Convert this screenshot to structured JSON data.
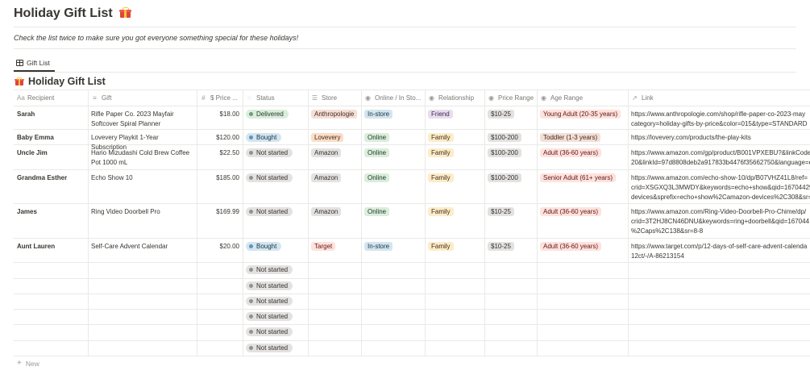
{
  "page": {
    "title": "Holiday Gift List",
    "title_emoji": "gift-icon",
    "description": "Check the list twice to make sure you got everyone something special for these holidays!"
  },
  "view_tab": {
    "label": "Gift List",
    "icon": "table-icon"
  },
  "database": {
    "title": "Holiday Gift List",
    "icon": "gift-icon"
  },
  "columns": [
    {
      "label": "Recipient",
      "icon": "Aa"
    },
    {
      "label": "Gift",
      "icon": "text-icon"
    },
    {
      "label": "$ Price ...",
      "icon": "#"
    },
    {
      "label": "Status",
      "icon": "status-icon"
    },
    {
      "label": "Store",
      "icon": "list-icon"
    },
    {
      "label": "Online / In Sto...",
      "icon": "select-icon"
    },
    {
      "label": "Relationship",
      "icon": "select-icon"
    },
    {
      "label": "Price Range",
      "icon": "select-icon"
    },
    {
      "label": "Age Range",
      "icon": "select-icon"
    },
    {
      "label": "Link",
      "icon": "link-icon"
    }
  ],
  "rows": [
    {
      "recipient": "Sarah",
      "gift": "Rifle Paper Co. 2023 Mayfair Softcover Spiral Planner",
      "price": "$18.00",
      "status": "Delivered",
      "store": "Anthropologie",
      "online": "In-store",
      "relationship": "Friend",
      "price_range": "$10-25",
      "age_range": "Young Adult (20-35 years)",
      "link": "https://www.anthropologie.com/shop/rifle-paper-co-2023-may\ncategory=holiday-gifts-by-price&color=015&type=STANDARD"
    },
    {
      "recipient": "Baby Emma",
      "gift": "Lovevery Playkit 1-Year Subscription",
      "price": "$120.00",
      "status": "Bought",
      "store": "Lovevery",
      "online": "Online",
      "relationship": "Family",
      "price_range": "$100-200",
      "age_range": "Toddler (1-3 years)",
      "link": "https://lovevery.com/products/the-play-kits"
    },
    {
      "recipient": "Uncle Jim",
      "gift": "Hario Mizudashi Cold Brew Coffee Pot 1000 mL",
      "price": "$22.50",
      "status": "Not started",
      "store": "Amazon",
      "online": "Online",
      "relationship": "Family",
      "price_range": "$100-200",
      "age_range": "Adult (36-60 years)",
      "link": "https://www.amazon.com/gp/product/B001VPXEBU?&linkCode\n20&linkId=97d8808deb2a917833b4476f35662750&language=e"
    },
    {
      "recipient": "Grandma Esther",
      "gift": "Echo Show 10",
      "price": "$185.00",
      "status": "Not started",
      "store": "Amazon",
      "online": "Online",
      "relationship": "Family",
      "price_range": "$100-200",
      "age_range": "Senior Adult (61+ years)",
      "link": "https://www.amazon.com/echo-show-10/dp/B07VHZ41L8/ref=\ncrid=XSGXQ3L3MWDY&keywords=echo+show&qid=16704429\ndevices&sprefix=echo+show%2Camazon-devices%2C308&sr=1"
    },
    {
      "recipient": "James",
      "gift": "Ring Video Doorbell Pro",
      "price": "$169.99",
      "status": "Not started",
      "store": "Amazon",
      "online": "Online",
      "relationship": "Family",
      "price_range": "$10-25",
      "age_range": "Adult (36-60 years)",
      "link": "https://www.amazon.com/Ring-Video-Doorbell-Pro-Chime/dp/\ncrid=3T2HJ8CN46DNU&keywords=ring+doorbell&qid=167044\n%2Caps%2C138&sr=8-8"
    },
    {
      "recipient": "Aunt Lauren",
      "gift": "Self-Care Advent Calendar",
      "price": "$20.00",
      "status": "Bought",
      "store": "Target",
      "online": "In-store",
      "relationship": "Family",
      "price_range": "$10-25",
      "age_range": "Adult (36-60 years)",
      "link": "https://www.target.com/p/12-days-of-self-care-advent-calenda\n12ct/-/A-86213154"
    }
  ],
  "empty_rows": [
    {
      "status": "Not started"
    },
    {
      "status": "Not started"
    },
    {
      "status": "Not started"
    },
    {
      "status": "Not started"
    },
    {
      "status": "Not started"
    },
    {
      "status": "Not started"
    }
  ],
  "new_row_label": "New",
  "colors": {
    "delivered": "#dbeddb",
    "bought": "#d3e5ef",
    "not_started": "#e3e2e0",
    "text": "#37352f",
    "muted": "#787774"
  }
}
